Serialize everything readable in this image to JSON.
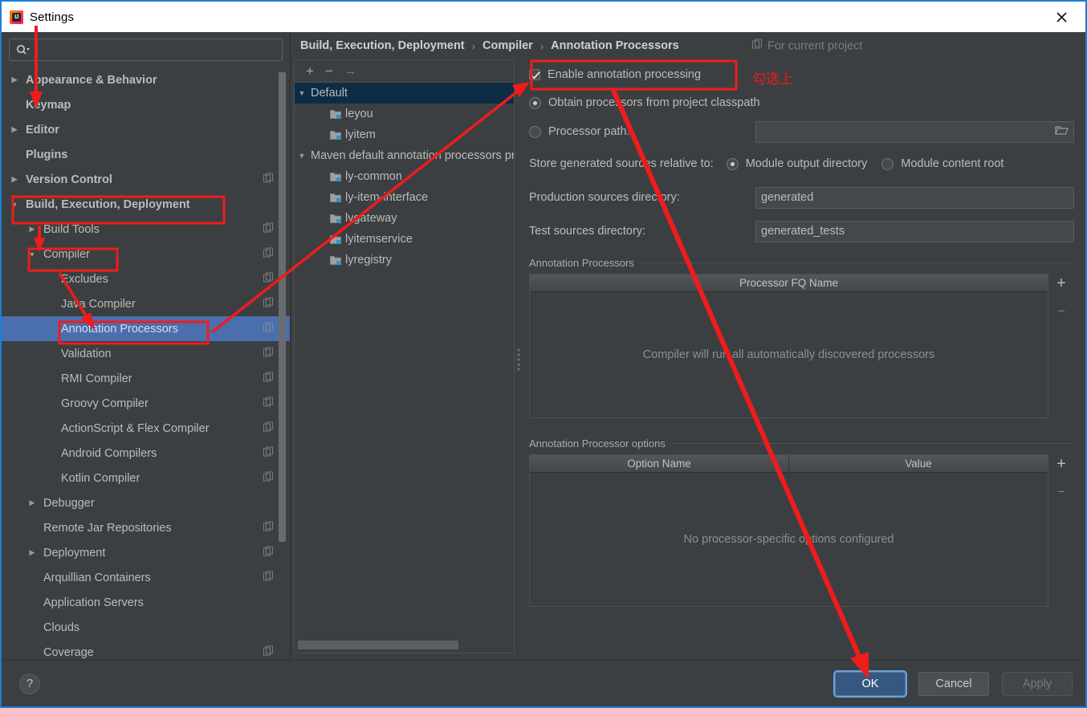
{
  "window": {
    "title": "Settings",
    "app_icon": "intellij-idea-logo",
    "close_icon": "close-icon"
  },
  "sidebar": {
    "search": {
      "placeholder": "",
      "value": "",
      "icon": "search-icon"
    },
    "items": [
      {
        "label": "Appearance & Behavior",
        "arrow": "collapsed",
        "indent": 0,
        "bold": true,
        "copy": false,
        "selected": false
      },
      {
        "label": "Keymap",
        "arrow": "none",
        "indent": 0,
        "bold": true,
        "copy": false,
        "selected": false
      },
      {
        "label": "Editor",
        "arrow": "collapsed",
        "indent": 0,
        "bold": true,
        "copy": false,
        "selected": false
      },
      {
        "label": "Plugins",
        "arrow": "none",
        "indent": 0,
        "bold": true,
        "copy": false,
        "selected": false
      },
      {
        "label": "Version Control",
        "arrow": "collapsed",
        "indent": 0,
        "bold": true,
        "copy": true,
        "selected": false
      },
      {
        "label": "Build, Execution, Deployment",
        "arrow": "expanded",
        "indent": 0,
        "bold": true,
        "copy": false,
        "selected": false
      },
      {
        "label": "Build Tools",
        "arrow": "collapsed",
        "indent": 1,
        "bold": false,
        "copy": true,
        "selected": false
      },
      {
        "label": "Compiler",
        "arrow": "expanded",
        "indent": 1,
        "bold": false,
        "copy": true,
        "selected": false
      },
      {
        "label": "Excludes",
        "arrow": "none",
        "indent": 2,
        "bold": false,
        "copy": true,
        "selected": false
      },
      {
        "label": "Java Compiler",
        "arrow": "none",
        "indent": 2,
        "bold": false,
        "copy": true,
        "selected": false
      },
      {
        "label": "Annotation Processors",
        "arrow": "none",
        "indent": 2,
        "bold": false,
        "copy": true,
        "selected": true
      },
      {
        "label": "Validation",
        "arrow": "none",
        "indent": 2,
        "bold": false,
        "copy": true,
        "selected": false
      },
      {
        "label": "RMI Compiler",
        "arrow": "none",
        "indent": 2,
        "bold": false,
        "copy": true,
        "selected": false
      },
      {
        "label": "Groovy Compiler",
        "arrow": "none",
        "indent": 2,
        "bold": false,
        "copy": true,
        "selected": false
      },
      {
        "label": "ActionScript & Flex Compiler",
        "arrow": "none",
        "indent": 2,
        "bold": false,
        "copy": true,
        "selected": false
      },
      {
        "label": "Android Compilers",
        "arrow": "none",
        "indent": 2,
        "bold": false,
        "copy": true,
        "selected": false
      },
      {
        "label": "Kotlin Compiler",
        "arrow": "none",
        "indent": 2,
        "bold": false,
        "copy": true,
        "selected": false
      },
      {
        "label": "Debugger",
        "arrow": "collapsed",
        "indent": 1,
        "bold": false,
        "copy": false,
        "selected": false
      },
      {
        "label": "Remote Jar Repositories",
        "arrow": "none",
        "indent": 1,
        "bold": false,
        "copy": true,
        "selected": false
      },
      {
        "label": "Deployment",
        "arrow": "collapsed",
        "indent": 1,
        "bold": false,
        "copy": true,
        "selected": false
      },
      {
        "label": "Arquillian Containers",
        "arrow": "none",
        "indent": 1,
        "bold": false,
        "copy": true,
        "selected": false
      },
      {
        "label": "Application Servers",
        "arrow": "none",
        "indent": 1,
        "bold": false,
        "copy": false,
        "selected": false
      },
      {
        "label": "Clouds",
        "arrow": "none",
        "indent": 1,
        "bold": false,
        "copy": false,
        "selected": false
      },
      {
        "label": "Coverage",
        "arrow": "none",
        "indent": 1,
        "bold": false,
        "copy": true,
        "selected": false
      }
    ]
  },
  "breadcrumb": {
    "items": [
      "Build, Execution, Deployment",
      "Compiler",
      "Annotation Processors"
    ],
    "separator": "›",
    "for_current_project": "For current project",
    "for_current_project_icon": "copy-icon"
  },
  "modules": {
    "toolbar": {
      "add": "+",
      "remove": "−",
      "move": "→"
    },
    "rows": [
      {
        "label": "Default",
        "type": "group",
        "arrow": "expanded",
        "selected": true
      },
      {
        "label": "leyou",
        "type": "module",
        "arrow": "none",
        "selected": false
      },
      {
        "label": "lyitem",
        "type": "module",
        "arrow": "none",
        "selected": false
      },
      {
        "label": "Maven default annotation processors profile",
        "type": "group",
        "arrow": "expanded",
        "selected": false
      },
      {
        "label": "ly-common",
        "type": "module",
        "arrow": "none",
        "selected": false
      },
      {
        "label": "ly-item-interface",
        "type": "module",
        "arrow": "none",
        "selected": false
      },
      {
        "label": "lygateway",
        "type": "module",
        "arrow": "none",
        "selected": false
      },
      {
        "label": "lyitemservice",
        "type": "module",
        "arrow": "none",
        "selected": false
      },
      {
        "label": "lyregistry",
        "type": "module",
        "arrow": "none",
        "selected": false
      }
    ]
  },
  "settings": {
    "enable_annotation_processing": {
      "label": "Enable annotation processing",
      "checked": true
    },
    "obtain_from_classpath": {
      "label": "Obtain processors from project classpath",
      "selected": true
    },
    "processor_path": {
      "label": "Processor path:",
      "selected": false,
      "value": "",
      "browse_icon": "folder-icon"
    },
    "store_relative_label": "Store generated sources relative to:",
    "store_relative_options": [
      {
        "label": "Module output directory",
        "selected": true
      },
      {
        "label": "Module content root",
        "selected": false
      }
    ],
    "production_sources": {
      "label": "Production sources directory:",
      "value": "generated"
    },
    "test_sources": {
      "label": "Test sources directory:",
      "value": "generated_tests"
    },
    "processors_section": {
      "title": "Annotation Processors",
      "column": "Processor FQ Name",
      "empty_text": "Compiler will run all automatically discovered processors",
      "add": "+",
      "remove": "−"
    },
    "options_section": {
      "title": "Annotation Processor options",
      "columns": [
        "Option Name",
        "Value"
      ],
      "empty_text": "No processor-specific options configured",
      "add": "+",
      "remove": "−"
    }
  },
  "footer": {
    "help": "?",
    "ok": "OK",
    "cancel": "Cancel",
    "apply": "Apply",
    "apply_disabled": true
  },
  "annotations": {
    "note_cjk": "勾选上",
    "color": "#ef1c1c"
  },
  "colors": {
    "accent_selection": "#4b6eaf",
    "inactive_selection": "#0d2c45",
    "primary_button": "#365880",
    "panel_bg": "#3c3f41",
    "annotation_red": "#ef1c1c",
    "window_border": "#1d7fd4"
  }
}
